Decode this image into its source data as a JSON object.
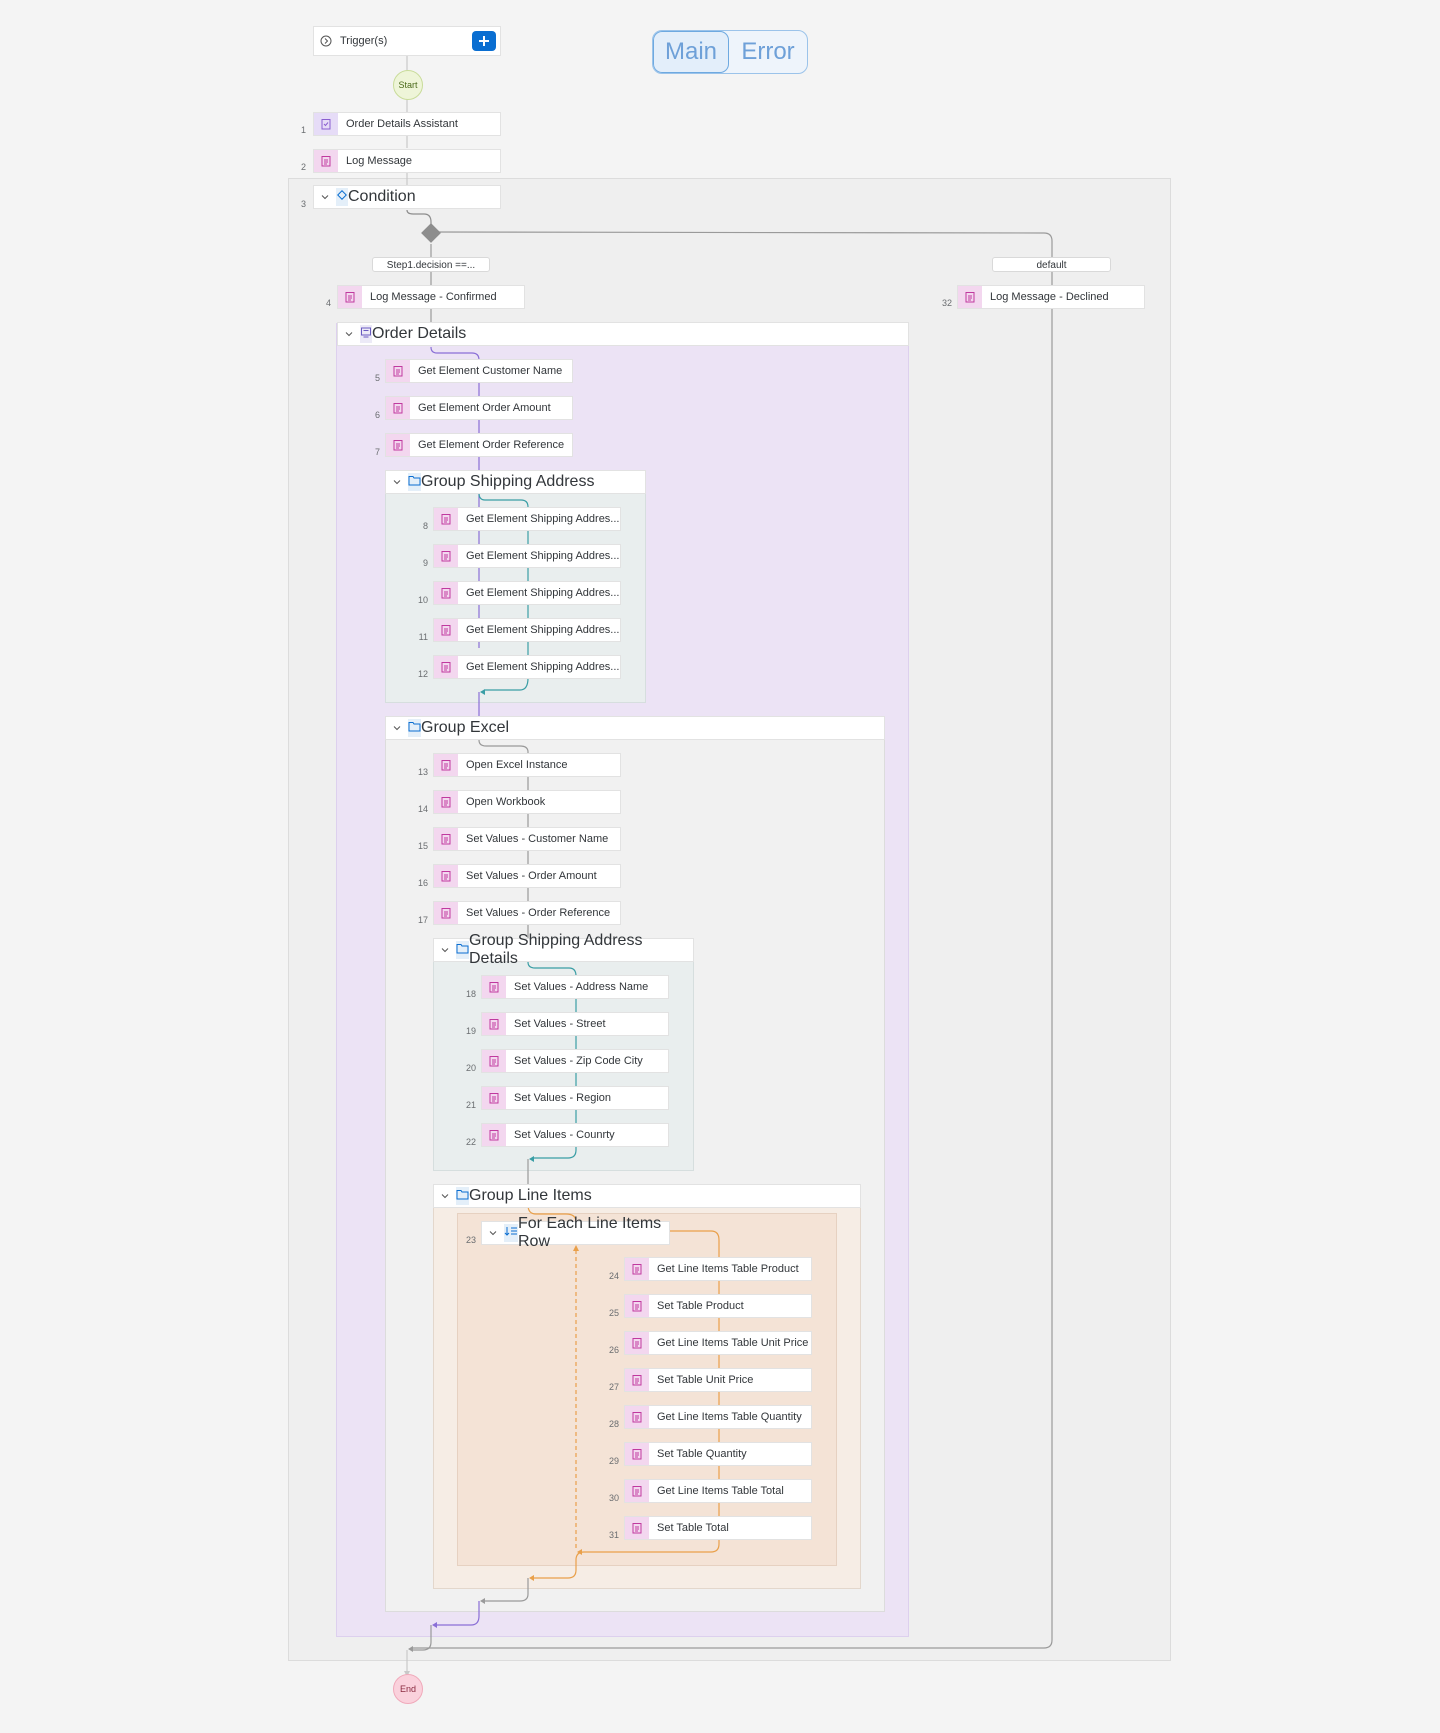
{
  "tabs": {
    "main": "Main",
    "error": "Error"
  },
  "triggers": {
    "label": "Trigger(s)"
  },
  "start": "Start",
  "end": "End",
  "branches": {
    "left": "Step1.decision ==...",
    "right": "default"
  },
  "steps": [
    {
      "num": "1",
      "label": "Order Details Assistant"
    },
    {
      "num": "2",
      "label": "Log Message"
    },
    {
      "num": "3",
      "label": "Condition"
    },
    {
      "num": "4",
      "label": "Log Message - Confirmed"
    },
    {
      "num": "",
      "label": "Order Details"
    },
    {
      "num": "5",
      "label": "Get Element Customer Name"
    },
    {
      "num": "6",
      "label": "Get Element Order Amount"
    },
    {
      "num": "7",
      "label": "Get Element Order Reference"
    },
    {
      "num": "",
      "label": "Group Shipping Address"
    },
    {
      "num": "8",
      "label": "Get Element Shipping Addres..."
    },
    {
      "num": "9",
      "label": "Get Element Shipping Addres..."
    },
    {
      "num": "10",
      "label": "Get Element Shipping Addres..."
    },
    {
      "num": "11",
      "label": "Get Element Shipping Addres..."
    },
    {
      "num": "12",
      "label": "Get Element Shipping Addres..."
    },
    {
      "num": "",
      "label": "Group Excel"
    },
    {
      "num": "13",
      "label": "Open Excel Instance"
    },
    {
      "num": "14",
      "label": "Open Workbook"
    },
    {
      "num": "15",
      "label": "Set Values - Customer Name"
    },
    {
      "num": "16",
      "label": "Set Values - Order Amount"
    },
    {
      "num": "17",
      "label": "Set Values - Order Reference"
    },
    {
      "num": "",
      "label": "Group Shipping Address Details"
    },
    {
      "num": "18",
      "label": "Set Values - Address Name"
    },
    {
      "num": "19",
      "label": "Set Values - Street"
    },
    {
      "num": "20",
      "label": "Set Values - Zip Code City"
    },
    {
      "num": "21",
      "label": "Set Values - Region"
    },
    {
      "num": "22",
      "label": "Set Values - Counrty"
    },
    {
      "num": "",
      "label": "Group Line Items"
    },
    {
      "num": "23",
      "label": "For Each Line Items Row"
    },
    {
      "num": "24",
      "label": "Get Line Items Table Product"
    },
    {
      "num": "25",
      "label": "Set Table Product"
    },
    {
      "num": "26",
      "label": "Get Line Items Table Unit Price"
    },
    {
      "num": "27",
      "label": "Set Table Unit Price"
    },
    {
      "num": "28",
      "label": "Get Line Items Table Quantity"
    },
    {
      "num": "29",
      "label": "Set Table Quantity"
    },
    {
      "num": "30",
      "label": "Get Line Items Table Total"
    },
    {
      "num": "31",
      "label": "Set Table Total"
    },
    {
      "num": "32",
      "label": "Log Message - Declined"
    }
  ],
  "colors": {
    "accent": "#0a6ed1",
    "action": "#c0399f",
    "teal": "#3a9ea5",
    "orange": "#e9a04a",
    "purple": "#8a6fd6"
  }
}
